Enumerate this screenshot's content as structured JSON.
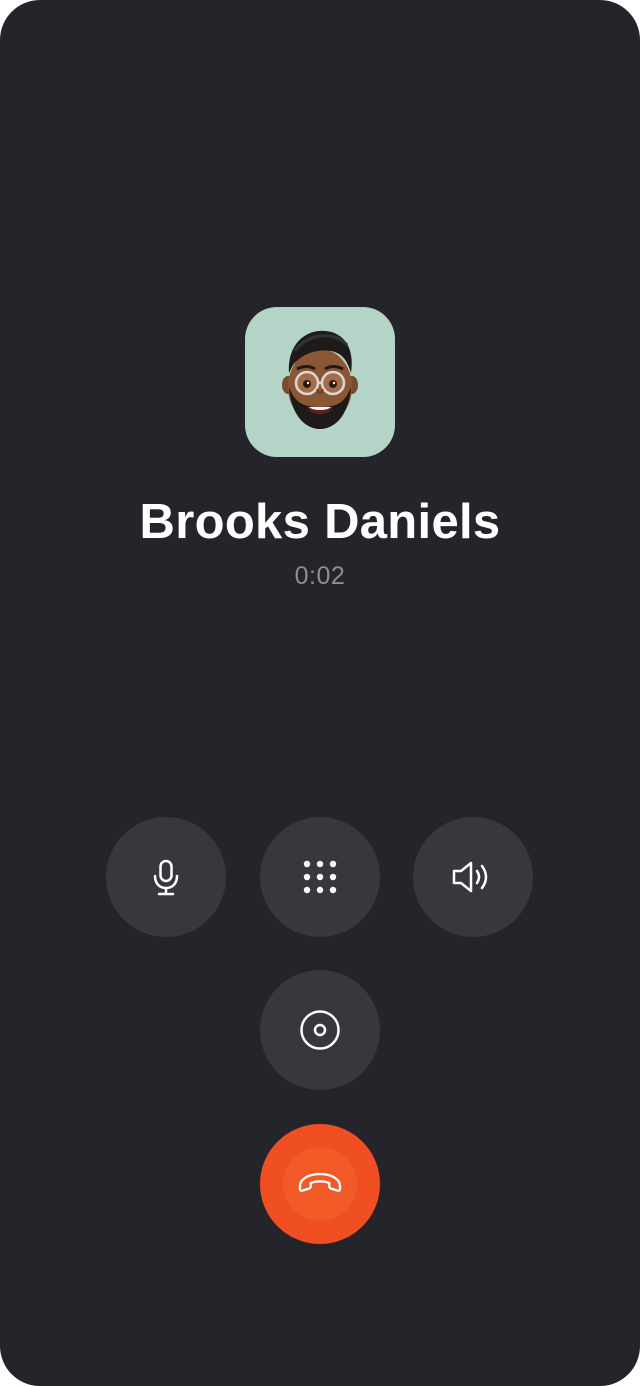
{
  "call": {
    "caller_name": "Brooks Daniels",
    "timer": "0:02"
  },
  "colors": {
    "background": "#25242a",
    "avatar_bg": "#b3d4c7",
    "control_bg": "#38373e",
    "end_call": "#ef4f23"
  },
  "controls": [
    {
      "id": "mute",
      "icon": "microphone-icon"
    },
    {
      "id": "keypad",
      "icon": "keypad-icon"
    },
    {
      "id": "speaker",
      "icon": "speaker-icon"
    },
    {
      "id": "record",
      "icon": "record-icon"
    },
    {
      "id": "end-call",
      "icon": "phone-hangup-icon"
    }
  ]
}
